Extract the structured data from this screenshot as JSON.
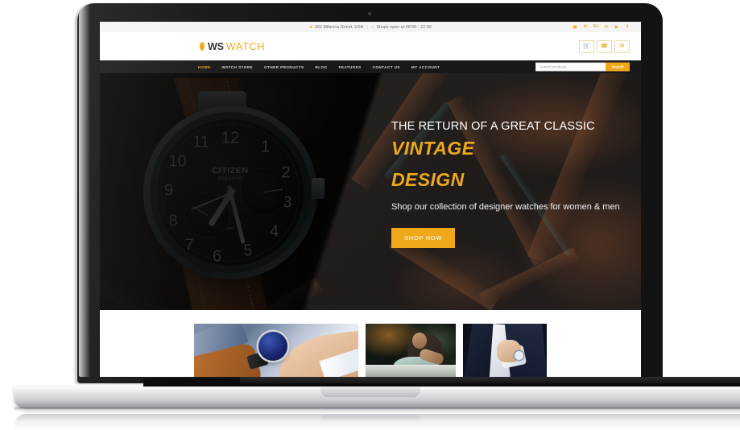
{
  "device": {
    "type": "laptop-mockup",
    "frame_color": "#131313",
    "base_color": "#c9cbce"
  },
  "site": {
    "accent_color": "#efa81a",
    "nav_bg": "#181818",
    "topbar": {
      "address": "262 Milacina Street, USA",
      "separator": "|",
      "hours": "Shops open at 08:00 - 22:30",
      "pin_icon": "location-pin-icon",
      "clock_icon": "clock-icon",
      "social": [
        {
          "name": "instagram",
          "glyph": "▣"
        },
        {
          "name": "linkedin",
          "glyph": "in"
        },
        {
          "name": "google-plus",
          "glyph": "G+"
        },
        {
          "name": "twitter",
          "glyph": "✉"
        },
        {
          "name": "youtube",
          "glyph": "▶"
        },
        {
          "name": "facebook",
          "glyph": "f"
        }
      ]
    },
    "header": {
      "logo_icon": "watch-icon",
      "logo_primary": "WS",
      "logo_secondary": "WATCH",
      "actions": [
        {
          "name": "cart",
          "glyph": "🛒",
          "label": "Cart"
        },
        {
          "name": "phone",
          "glyph": "✆",
          "label": "Call us"
        },
        {
          "name": "email",
          "glyph": "✉",
          "label": "Email us"
        }
      ]
    },
    "nav": {
      "items": [
        {
          "label": "HOME",
          "active": true
        },
        {
          "label": "WATCH STORE",
          "active": false
        },
        {
          "label": "OTHER PRODUCTS",
          "active": false
        },
        {
          "label": "BLOG",
          "active": false
        },
        {
          "label": "FEATURES",
          "active": false
        },
        {
          "label": "CONTACT US",
          "active": false
        },
        {
          "label": "MY ACCOUNT",
          "active": false
        }
      ]
    },
    "search": {
      "value": "",
      "placeholder": "Search products...",
      "button_label": "Search"
    },
    "hero": {
      "kicker": "THE RETURN OF A GREAT CLASSIC",
      "title_line1": "VINTAGE",
      "title_line2": "DESIGN",
      "subtitle": "Shop our collection of designer watches for women & men",
      "cta_label": "SHOP NOW",
      "image_alt": "Close-up of a vintage Citizen Eco-Drive chronograph watch with brown leather strap on rusty metal bars",
      "watch": {
        "brand": "CITIZEN",
        "sub_brand": "Eco-Drive",
        "date_text": "WR",
        "numerals": [
          "12",
          "1",
          "2",
          "3",
          "4",
          "5",
          "6",
          "7",
          "8",
          "9",
          "10",
          "11"
        ]
      }
    },
    "product_strip": {
      "cards": [
        {
          "name": "wrist-watch-on-desk",
          "alt": "Man's wrist wearing a blue dial watch resting on a desk"
        },
        {
          "name": "woman-at-restaurant",
          "alt": "Woman seated at a dimly lit restaurant table"
        },
        {
          "name": "man-in-suit",
          "alt": "Man in a dark suit adjusting his shirt cuff with a watch"
        }
      ]
    }
  }
}
